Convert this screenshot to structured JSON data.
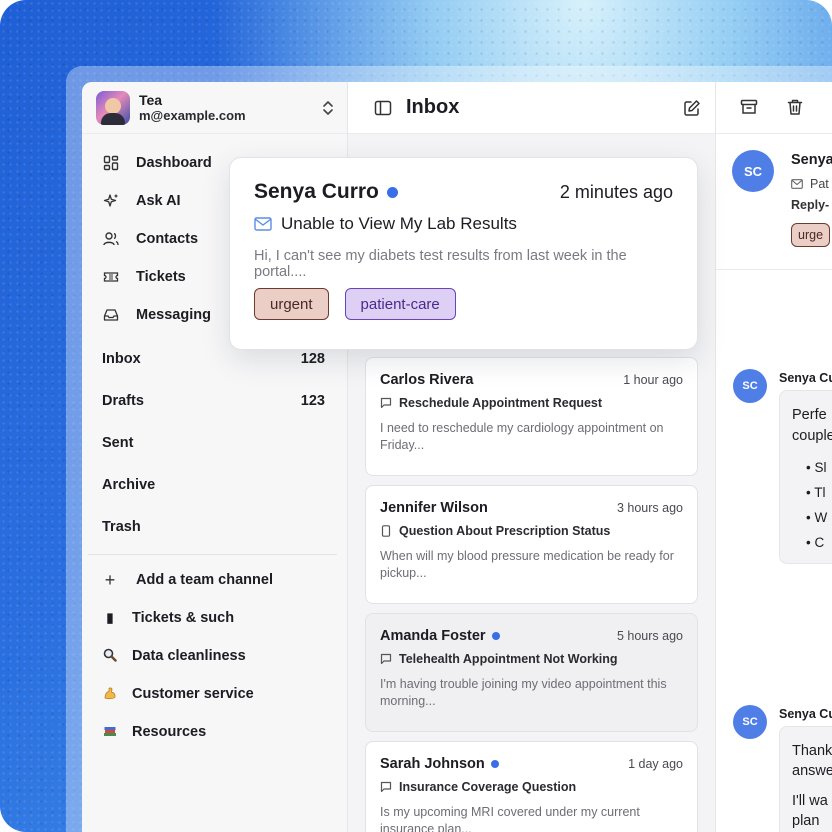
{
  "account": {
    "name": "Tea",
    "email": "m@example.com"
  },
  "nav": [
    {
      "label": "Dashboard",
      "icon": "dashboard-icon"
    },
    {
      "label": "Ask AI",
      "icon": "sparkle-icon"
    },
    {
      "label": "Contacts",
      "icon": "contacts-icon"
    },
    {
      "label": "Tickets",
      "icon": "ticket-icon"
    },
    {
      "label": "Messaging",
      "icon": "inbox-tray-icon"
    }
  ],
  "folders": [
    {
      "label": "Inbox",
      "count": "128"
    },
    {
      "label": "Drafts",
      "count": "123"
    },
    {
      "label": "Sent",
      "count": ""
    },
    {
      "label": "Archive",
      "count": ""
    },
    {
      "label": "Trash",
      "count": ""
    }
  ],
  "channels": {
    "add_label": "Add a team channel",
    "items": [
      {
        "label": "Tickets & such",
        "emoji": "📊"
      },
      {
        "label": "Data cleanliness",
        "emoji": "🔍"
      },
      {
        "label": "Customer service",
        "emoji": "💪"
      },
      {
        "label": "Resources",
        "emoji": "📚"
      }
    ]
  },
  "list": {
    "title": "Inbox",
    "messages": [
      {
        "name": "Carlos Rivera",
        "time": "1 hour ago",
        "subject": "Reschedule Appointment Request",
        "preview": "I need to reschedule my cardiology appointment on Friday...",
        "unread": false
      },
      {
        "name": "Jennifer Wilson",
        "time": "3 hours ago",
        "subject": "Question About Prescription Status",
        "preview": "When will my blood pressure medication be ready for pickup...",
        "unread": false
      },
      {
        "name": "Amanda Foster",
        "time": "5 hours ago",
        "subject": "Telehealth Appointment Not Working",
        "preview": "I'm having trouble joining my video appointment this morning...",
        "unread": true
      },
      {
        "name": "Sarah Johnson",
        "time": "1 day ago",
        "subject": "Insurance Coverage Question",
        "preview": "Is my upcoming MRI covered under my current insurance plan...",
        "unread": true
      }
    ]
  },
  "popup": {
    "name": "Senya Curro",
    "time": "2 minutes ago",
    "subject": "Unable to View My Lab Results",
    "preview": "Hi, I can't see my diabets test results from last week in the portal....",
    "tags": [
      "urgent",
      "patient-care"
    ]
  },
  "detail": {
    "initials": "SC",
    "sender": "Senya",
    "meta_line": "Pat",
    "reply_label": "Reply-",
    "tag": "urge",
    "thread": [
      {
        "sender": "Senya Cu",
        "lines": [
          "Perfe",
          "couple"
        ],
        "bullets": [
          "Sl",
          "Tl",
          "W",
          "C"
        ]
      },
      {
        "sender": "Senya Cu",
        "lines": [
          "Thank",
          "answe",
          "I'll wa",
          "plan"
        ],
        "bullets": []
      }
    ]
  },
  "colors": {
    "accent": "#3a6ee8",
    "avatar": "#4f7fe6",
    "urgent_bg": "#ebcfc7",
    "care_bg": "#ddd0f4"
  }
}
